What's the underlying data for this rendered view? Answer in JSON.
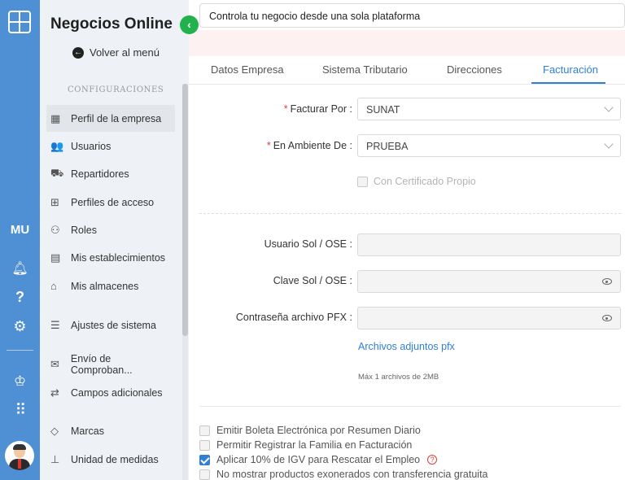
{
  "rail": {
    "initials": "MU",
    "icons": [
      "logo-icon",
      "bell-icon",
      "question-icon",
      "gear-icon",
      "award-icon",
      "apps-grid-icon",
      "avatar"
    ]
  },
  "sidebar": {
    "brand": "Negocios Online",
    "back_label": "Volver al menú",
    "section": "CONFIGURACIONES",
    "items": [
      {
        "label": "Perfil de la empresa",
        "icon": "building-icon",
        "glyph": "▦",
        "active": true
      },
      {
        "label": "Usuarios",
        "icon": "users-icon",
        "glyph": "👥"
      },
      {
        "label": "Repartidores",
        "icon": "truck-icon",
        "glyph": "⛟"
      },
      {
        "label": "Perfiles de acceso",
        "icon": "sitemap-icon",
        "glyph": "⊞"
      },
      {
        "label": "Roles",
        "icon": "user-roles-icon",
        "glyph": "⚇"
      },
      {
        "label": "Mis establecimientos",
        "icon": "store-icon",
        "glyph": "▤"
      },
      {
        "label": "Mis almacenes",
        "icon": "warehouse-icon",
        "glyph": "⌂"
      },
      {
        "label": "Ajustes de sistema",
        "icon": "sliders-icon",
        "glyph": "☰"
      },
      {
        "label": "Envío de Comproban...",
        "icon": "mail-icon",
        "glyph": "✉"
      },
      {
        "label": "Campos adicionales",
        "icon": "share-icon",
        "glyph": "⇄"
      },
      {
        "label": "Marcas",
        "icon": "tag-icon",
        "glyph": "◇"
      },
      {
        "label": "Unidad de medidas",
        "icon": "ruler-icon",
        "glyph": "⊥"
      }
    ]
  },
  "header": {
    "text": "Controla tu negocio desde una sola plataforma"
  },
  "tabs": [
    {
      "label": "Datos Empresa"
    },
    {
      "label": "Sistema Tributario"
    },
    {
      "label": "Direcciones"
    },
    {
      "label": "Facturación",
      "active": true
    }
  ],
  "form": {
    "facturar_label": "Facturar Por",
    "facturar_value": "SUNAT",
    "ambiente_label": "En Ambiente De",
    "ambiente_value": "PRUEBA",
    "cert_label": "Con Certificado Propio",
    "usuario_label": "Usuario Sol / OSE",
    "clave_label": "Clave Sol / OSE",
    "pfx_label": "Contraseña archivo PFX",
    "colon": ":",
    "attachments_link": "Archivos adjuntos pfx",
    "attachments_hint": "Máx 1 archivos de 2MB"
  },
  "options": [
    {
      "label": "Emitir Boleta Electrónica por Resumen Diario",
      "checked": false
    },
    {
      "label": "Permitir Registrar la Familia en Facturación",
      "checked": false
    },
    {
      "label": "Aplicar 10% de IGV para Rescatar el Empleo",
      "checked": true
    },
    {
      "label": "No mostrar productos exonerados con transferencia gratuita",
      "checked": false
    }
  ],
  "colors": {
    "rail": "#4f8fd4",
    "accent": "#2f7fd6",
    "green": "#22b24c",
    "required": "#e03b3b"
  }
}
